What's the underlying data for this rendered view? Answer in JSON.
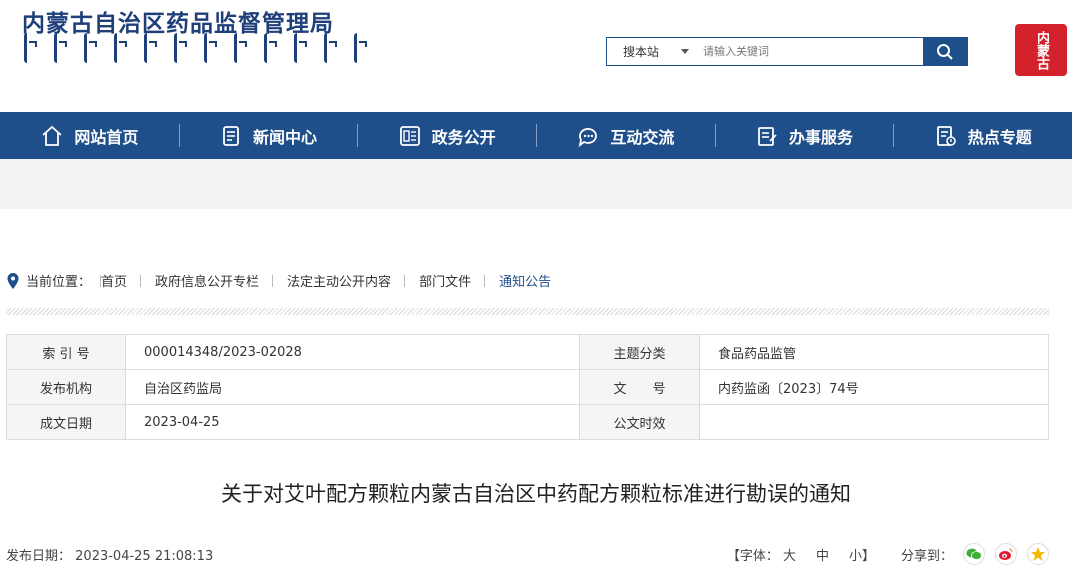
{
  "header": {
    "site_title": "内蒙古自治区药品监督管理局",
    "search_scope": "搜本站",
    "search_placeholder": "请输入关键词",
    "seal_text": "内蒙古"
  },
  "nav": {
    "items": [
      {
        "label": "网站首页",
        "icon": "home-icon"
      },
      {
        "label": "新闻中心",
        "icon": "news-icon"
      },
      {
        "label": "政务公开",
        "icon": "document-icon"
      },
      {
        "label": "互动交流",
        "icon": "chat-icon"
      },
      {
        "label": "办事服务",
        "icon": "service-icon"
      },
      {
        "label": "热点专题",
        "icon": "topic-icon"
      }
    ]
  },
  "breadcrumb": {
    "prefix": "当前位置：",
    "items": [
      "首页",
      "政府信息公开专栏",
      "法定主动公开内容",
      "部门文件",
      "通知公告"
    ]
  },
  "info": {
    "rows": [
      {
        "l1": "索 引 号",
        "v1": "000014348/2023-02028",
        "l2": "主题分类",
        "v2": "食品药品监管"
      },
      {
        "l1": "发布机构",
        "v1": "自治区药监局",
        "l2": "文　　号",
        "v2": "内药监函〔2023〕74号"
      },
      {
        "l1": "成文日期",
        "v1": "2023-04-25",
        "l2": "公文时效",
        "v2": ""
      }
    ]
  },
  "article": {
    "title": "关于对艾叶配方颗粒内蒙古自治区中药配方颗粒标准进行勘误的通知",
    "publish_label": "发布日期：",
    "publish_date": "2023-04-25 21:08:13",
    "font_label": "【字体：",
    "font_large": "大",
    "font_medium": "中",
    "font_small": "小】",
    "share_label": "分享到："
  },
  "colors": {
    "brand": "#1f4f8a",
    "seal": "#d3222b"
  }
}
